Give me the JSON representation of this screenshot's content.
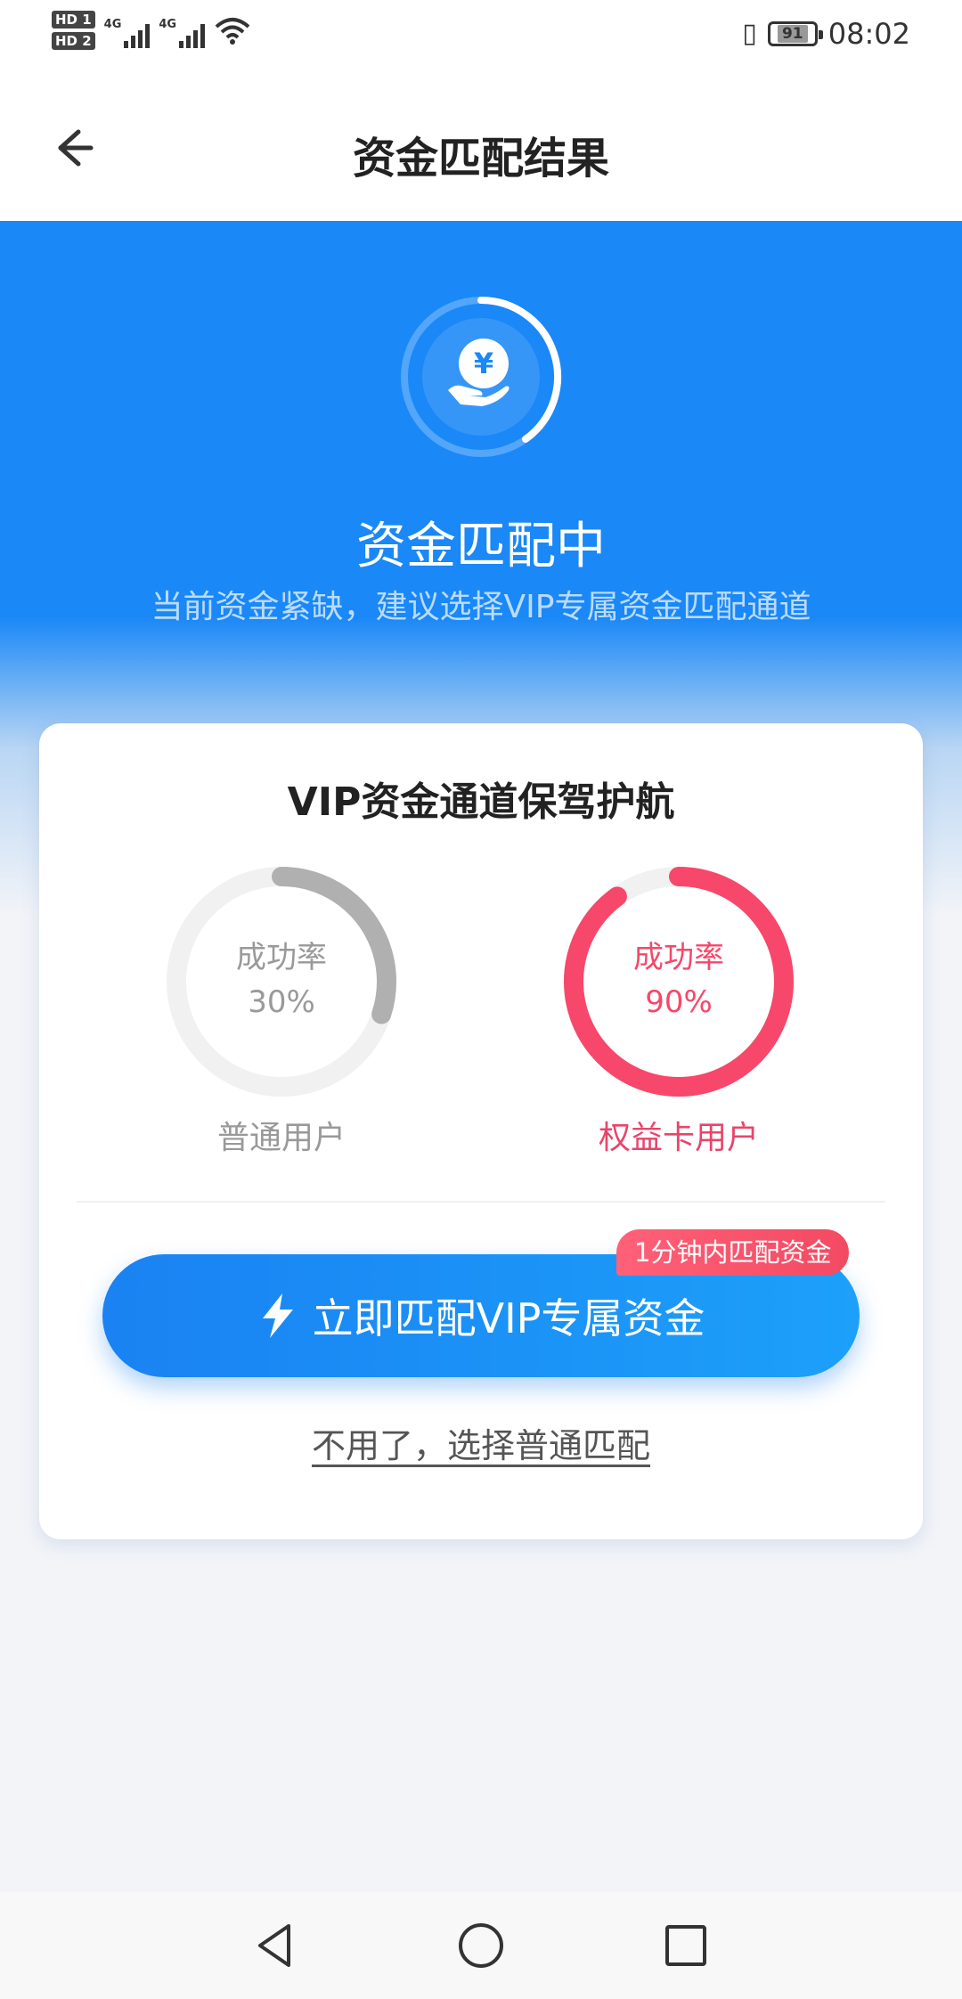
{
  "status_bar": {
    "hd1": "HD 1",
    "hd2": "HD 2",
    "signal1_label": "4G",
    "signal2_label": "4G",
    "battery": "91",
    "time": "08:02"
  },
  "header": {
    "title": "资金匹配结果"
  },
  "hero": {
    "icon": "yen-hand-icon",
    "title": "资金匹配中",
    "subtitle": "当前资金紧缺，建议选择VIP专属资金匹配通道"
  },
  "card": {
    "title": "VIP资金通道保驾护航",
    "regular": {
      "rate_label": "成功率",
      "rate_value": "30%",
      "rate_fraction": 0.3,
      "user_label": "普通用户",
      "color": "#b0b0b0"
    },
    "vip": {
      "rate_label": "成功率",
      "rate_value": "90%",
      "rate_fraction": 0.9,
      "user_label": "权益卡用户",
      "color": "#f7476a"
    },
    "badge": "1分钟内匹配资金",
    "cta_label": "立即匹配VIP专属资金",
    "skip_label": "不用了，选择普通匹配"
  },
  "colors": {
    "primary": "#1a88f7",
    "accent_red": "#f7476a"
  },
  "nav_bar": {
    "back_icon": "triangle-back-icon",
    "home_icon": "circle-home-icon",
    "recents_icon": "square-recents-icon"
  }
}
